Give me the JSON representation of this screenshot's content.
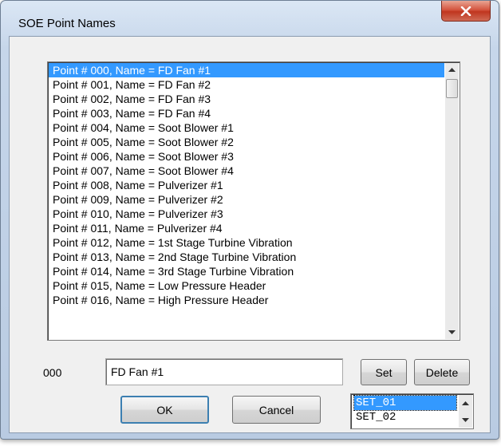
{
  "window": {
    "title": "SOE Point Names",
    "close_icon": "close-x-icon"
  },
  "points_list": {
    "items": [
      "Point # 000, Name = FD Fan #1",
      "Point # 001, Name = FD Fan #2",
      "Point # 002, Name = FD Fan #3",
      "Point # 003, Name = FD Fan #4",
      "Point # 004, Name = Soot Blower #1",
      "Point # 005, Name = Soot Blower #2",
      "Point # 006, Name = Soot Blower #3",
      "Point # 007, Name = Soot Blower #4",
      "Point # 008, Name = Pulverizer #1",
      "Point # 009, Name = Pulverizer #2",
      "Point # 010, Name = Pulverizer #3",
      "Point # 011, Name = Pulverizer #4",
      "Point # 012, Name = 1st Stage Turbine Vibration",
      "Point # 013, Name = 2nd Stage Turbine Vibration",
      "Point # 014, Name = 3rd Stage Turbine Vibration",
      "Point # 015, Name = Low Pressure Header",
      "Point # 016, Name = High Pressure Header"
    ],
    "selected_index": 0
  },
  "editor": {
    "index_label": "000",
    "name_value": "FD Fan #1",
    "set_label": "Set",
    "delete_label": "Delete"
  },
  "footer": {
    "ok_label": "OK",
    "cancel_label": "Cancel"
  },
  "sets_list": {
    "items": [
      "SET_01",
      "SET_02"
    ],
    "selected_index": 0
  },
  "colors": {
    "selection": "#3399ff",
    "close_button": "#c0361f"
  }
}
